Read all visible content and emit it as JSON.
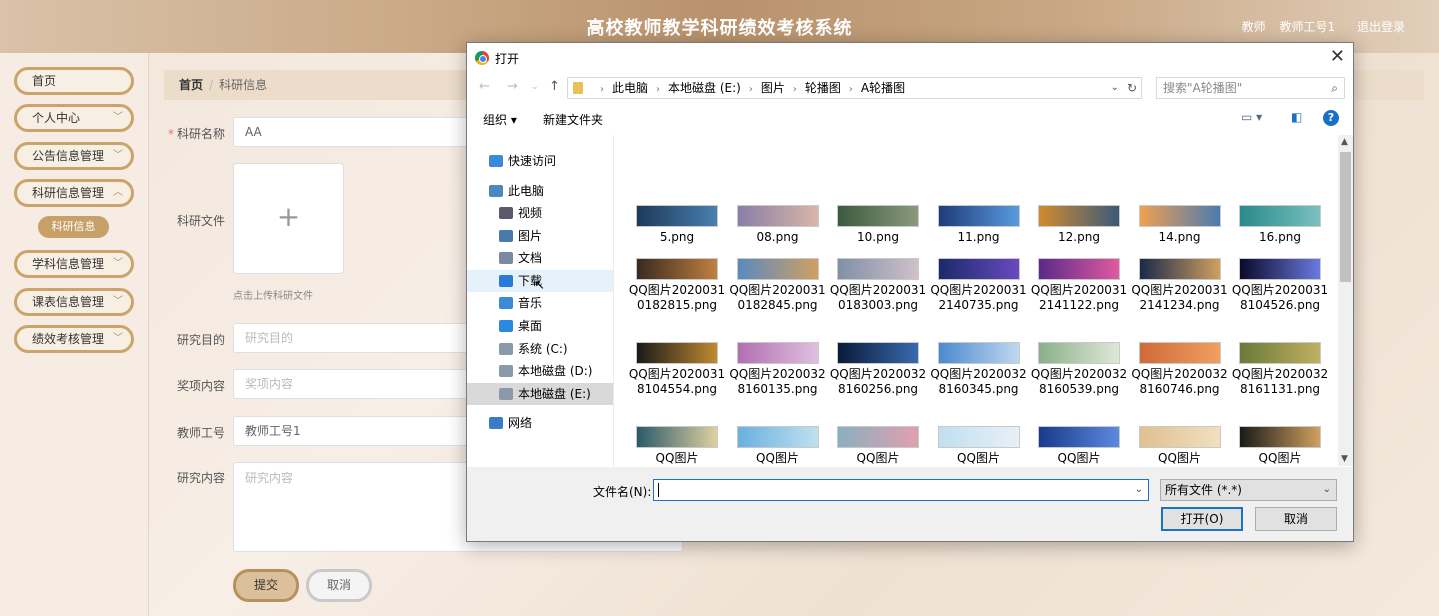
{
  "header": {
    "title": "高校教师教学科研绩效考核系统",
    "role": "教师",
    "user": "教师工号1",
    "logout": "退出登录"
  },
  "sidebar": {
    "items": [
      {
        "label": "首页",
        "chevron": false
      },
      {
        "label": "个人中心",
        "chevron": true
      },
      {
        "label": "公告信息管理",
        "chevron": true
      },
      {
        "label": "科研信息管理",
        "chevron": true
      },
      {
        "label": "学科信息管理",
        "chevron": true
      },
      {
        "label": "课表信息管理",
        "chevron": true
      },
      {
        "label": "绩效考核管理",
        "chevron": true
      }
    ],
    "active_sub": "科研信息"
  },
  "breadcrumb": {
    "home": "首页",
    "separator": "/",
    "current": "科研信息"
  },
  "form": {
    "name_label": "科研名称",
    "name_value": "AA",
    "file_label": "科研文件",
    "upload_tip": "点击上传科研文件",
    "purpose_label": "研究目的",
    "purpose_placeholder": "研究目的",
    "award_label": "奖项内容",
    "award_placeholder": "奖项内容",
    "teacher_label": "教师工号",
    "teacher_value": "教师工号1",
    "content_label": "研究内容",
    "content_placeholder": "研究内容",
    "submit": "提交",
    "cancel": "取消"
  },
  "dialog": {
    "title": "打开",
    "close": "✕",
    "path": [
      "此电脑",
      "本地磁盘 (E:)",
      "图片",
      "轮播图",
      "A轮播图"
    ],
    "search_placeholder": "搜索\"A轮播图\"",
    "organize": "组织",
    "new_folder": "新建文件夹",
    "tree": [
      {
        "label": "快速访问",
        "icon": "star-icon",
        "state": ""
      },
      {
        "label": "此电脑",
        "icon": "computer-icon",
        "state": ""
      },
      {
        "label": "视频",
        "icon": "video-icon",
        "state": ""
      },
      {
        "label": "图片",
        "icon": "pictures-icon",
        "state": ""
      },
      {
        "label": "文档",
        "icon": "documents-icon",
        "state": ""
      },
      {
        "label": "下载",
        "icon": "download-icon",
        "state": "hover"
      },
      {
        "label": "音乐",
        "icon": "music-icon",
        "state": ""
      },
      {
        "label": "桌面",
        "icon": "desktop-icon",
        "state": ""
      },
      {
        "label": "系统 (C:)",
        "icon": "drive-icon",
        "state": ""
      },
      {
        "label": "本地磁盘 (D:)",
        "icon": "drive-icon",
        "state": ""
      },
      {
        "label": "本地磁盘 (E:)",
        "icon": "drive-icon",
        "state": "selected"
      },
      {
        "label": "网络",
        "icon": "network-icon",
        "state": ""
      }
    ],
    "files": [
      {
        "name": "5.png",
        "colors": [
          "#1d3a5a",
          "#4a7fb0"
        ]
      },
      {
        "name": "08.png",
        "colors": [
          "#8a7ea8",
          "#d8b6a8"
        ]
      },
      {
        "name": "10.png",
        "colors": [
          "#3d5a3e",
          "#8a9a7e"
        ]
      },
      {
        "name": "11.png",
        "colors": [
          "#1e3c78",
          "#5a9ae0"
        ]
      },
      {
        "name": "12.png",
        "colors": [
          "#d08a30",
          "#3a5a7a"
        ]
      },
      {
        "name": "14.png",
        "colors": [
          "#f0a050",
          "#4a7ab0"
        ]
      },
      {
        "name": "16.png",
        "colors": [
          "#2a8a8a",
          "#7ac0c0"
        ]
      },
      {
        "name": "QQ图片20200310182815.png",
        "colors": [
          "#3a2a20",
          "#c08040"
        ]
      },
      {
        "name": "QQ图片20200310182845.png",
        "colors": [
          "#5a8ac0",
          "#d0a060"
        ]
      },
      {
        "name": "QQ图片20200310183003.png",
        "colors": [
          "#8090a8",
          "#d0c0c8"
        ]
      },
      {
        "name": "QQ图片20200312140735.png",
        "colors": [
          "#1a2a6a",
          "#6a4ac0"
        ]
      },
      {
        "name": "QQ图片20200312141122.png",
        "colors": [
          "#5a2a8a",
          "#e05aa0"
        ]
      },
      {
        "name": "QQ图片20200312141234.png",
        "colors": [
          "#1a2a4a",
          "#d0a060"
        ]
      },
      {
        "name": "QQ图片20200318104526.png",
        "colors": [
          "#0a0a2a",
          "#6a7ae0"
        ]
      },
      {
        "name": "QQ图片20200318104554.png",
        "colors": [
          "#1a1a1a",
          "#c08a30"
        ]
      },
      {
        "name": "QQ图片20200328160135.png",
        "colors": [
          "#b070b0",
          "#e0c0e0"
        ]
      },
      {
        "name": "QQ图片20200328160256.png",
        "colors": [
          "#0a1a3a",
          "#3a6ab0"
        ]
      },
      {
        "name": "QQ图片20200328160345.png",
        "colors": [
          "#4a8ad0",
          "#c0d8f0"
        ]
      },
      {
        "name": "QQ图片20200328160539.png",
        "colors": [
          "#8ab08a",
          "#e0e8d8"
        ]
      },
      {
        "name": "QQ图片20200328160746.png",
        "colors": [
          "#d06a3a",
          "#f0a060"
        ]
      },
      {
        "name": "QQ图片20200328161131.png",
        "colors": [
          "#6a7a3a",
          "#c0b060"
        ]
      },
      {
        "name": "QQ图片",
        "colors": [
          "#2a5a6a",
          "#e0d0a0"
        ]
      },
      {
        "name": "QQ图片",
        "colors": [
          "#6ab0e0",
          "#c0e0f0"
        ]
      },
      {
        "name": "QQ图片",
        "colors": [
          "#8ab0c0",
          "#e0a0b0"
        ]
      },
      {
        "name": "QQ图片",
        "colors": [
          "#c0e0f0",
          "#e8f0f8"
        ]
      },
      {
        "name": "QQ图片",
        "colors": [
          "#1a3a8a",
          "#5a8ae0"
        ]
      },
      {
        "name": "QQ图片",
        "colors": [
          "#e0c090",
          "#f0e0c0"
        ]
      },
      {
        "name": "QQ图片",
        "colors": [
          "#1a1a1a",
          "#d0a060"
        ]
      }
    ],
    "filename_label": "文件名(N):",
    "filename_value": "",
    "filetype": "所有文件 (*.*)",
    "open": "打开(O)",
    "cancel": "取消"
  }
}
